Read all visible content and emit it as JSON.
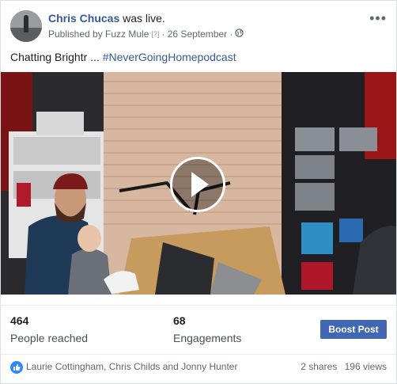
{
  "post": {
    "author": "Chris Chucas",
    "status": "was live.",
    "published_by": "Published by Fuzz Mule",
    "help_mark": "[?]",
    "date": "· 26 September ·",
    "text_prefix": "Chatting Brightr ... ",
    "hashtag": "#NeverGoingHomepodcast",
    "more_icon": "•••",
    "audience_icon": "globe-icon"
  },
  "stats": {
    "reached_value": "464",
    "reached_label": "People reached",
    "engagements_value": "68",
    "engagements_label": "Engagements",
    "boost_label": "Boost Post"
  },
  "footer": {
    "reactors": "Laurie Cottingham, Chris Childs and Jonny Hunter",
    "shares": "2 shares",
    "views": "196 views"
  },
  "colors": {
    "link_blue": "#365899",
    "button_blue": "#4267b2",
    "like_blue": "#2d88ff"
  }
}
